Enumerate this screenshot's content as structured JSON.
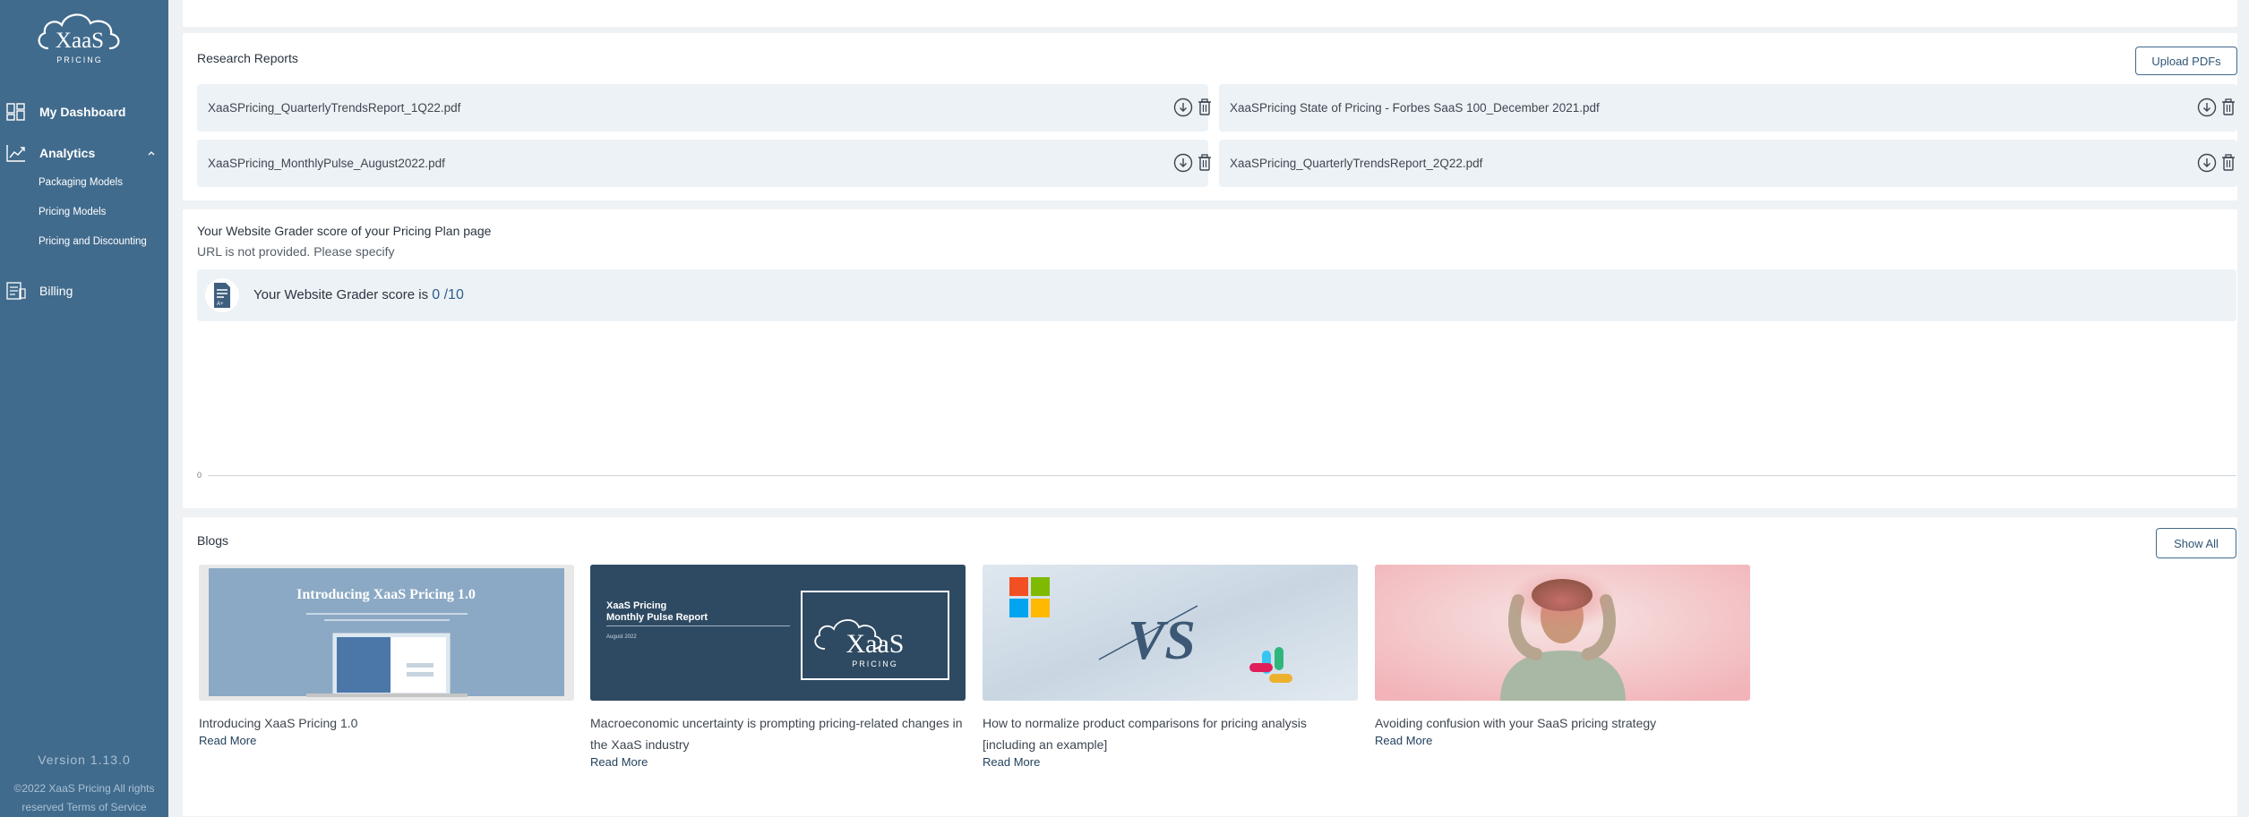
{
  "sidebar": {
    "logo_text": "XaaS",
    "logo_sub": "PRICING",
    "nav": [
      {
        "label": "My Dashboard",
        "icon": "dashboard-icon"
      },
      {
        "label": "Analytics",
        "icon": "analytics-icon"
      },
      {
        "label": "Billing",
        "icon": "billing-icon"
      }
    ],
    "analytics_sub": [
      "Packaging Models",
      "Pricing Models",
      "Pricing and Discounting"
    ],
    "version": "Version 1.13.0",
    "copyright_line1": "©2022 XaaS Pricing All rights",
    "copyright_line2": "reserved",
    "terms_label": "Terms of Service"
  },
  "reports": {
    "title": "Research Reports",
    "upload_label": "Upload PDFs",
    "files": [
      "XaaSPricing_QuarterlyTrendsReport_1Q22.pdf",
      "XaaSPricing State of Pricing - Forbes SaaS 100_December 2021.pdf",
      "XaaSPricing_MonthlyPulse_August2022.pdf",
      "XaaSPricing_QuarterlyTrendsReport_2Q22.pdf"
    ]
  },
  "grader": {
    "title": "Your Website Grader score of your Pricing Plan page",
    "subtitle": "URL is not provided.  Please specify",
    "score_label": "Your Website Grader score is ",
    "score_value": "0 /10",
    "axis_zero": "0"
  },
  "blogs": {
    "title": "Blogs",
    "show_all_label": "Show All",
    "read_more_label": "Read More",
    "items": [
      {
        "title": "Introducing XaaS Pricing 1.0",
        "thumb_heading": "Introducing XaaS Pricing 1.0"
      },
      {
        "title": "Macroeconomic uncertainty is prompting pricing-related changes in the XaaS industry",
        "thumb_heading_line1": "XaaS Pricing",
        "thumb_heading_line2": "Monthly Pulse Report",
        "thumb_date": "August 2022",
        "thumb_logo": "XaaS",
        "thumb_logo_sub": "PRICING"
      },
      {
        "title": "How to normalize product comparisons for pricing analysis [including an example]",
        "thumb_vs": "VS"
      },
      {
        "title": "Avoiding confusion with your SaaS pricing strategy"
      }
    ]
  },
  "colors": {
    "sidebar": "#416b8d",
    "accent": "#2e5577",
    "panel": "#edf2f6"
  }
}
